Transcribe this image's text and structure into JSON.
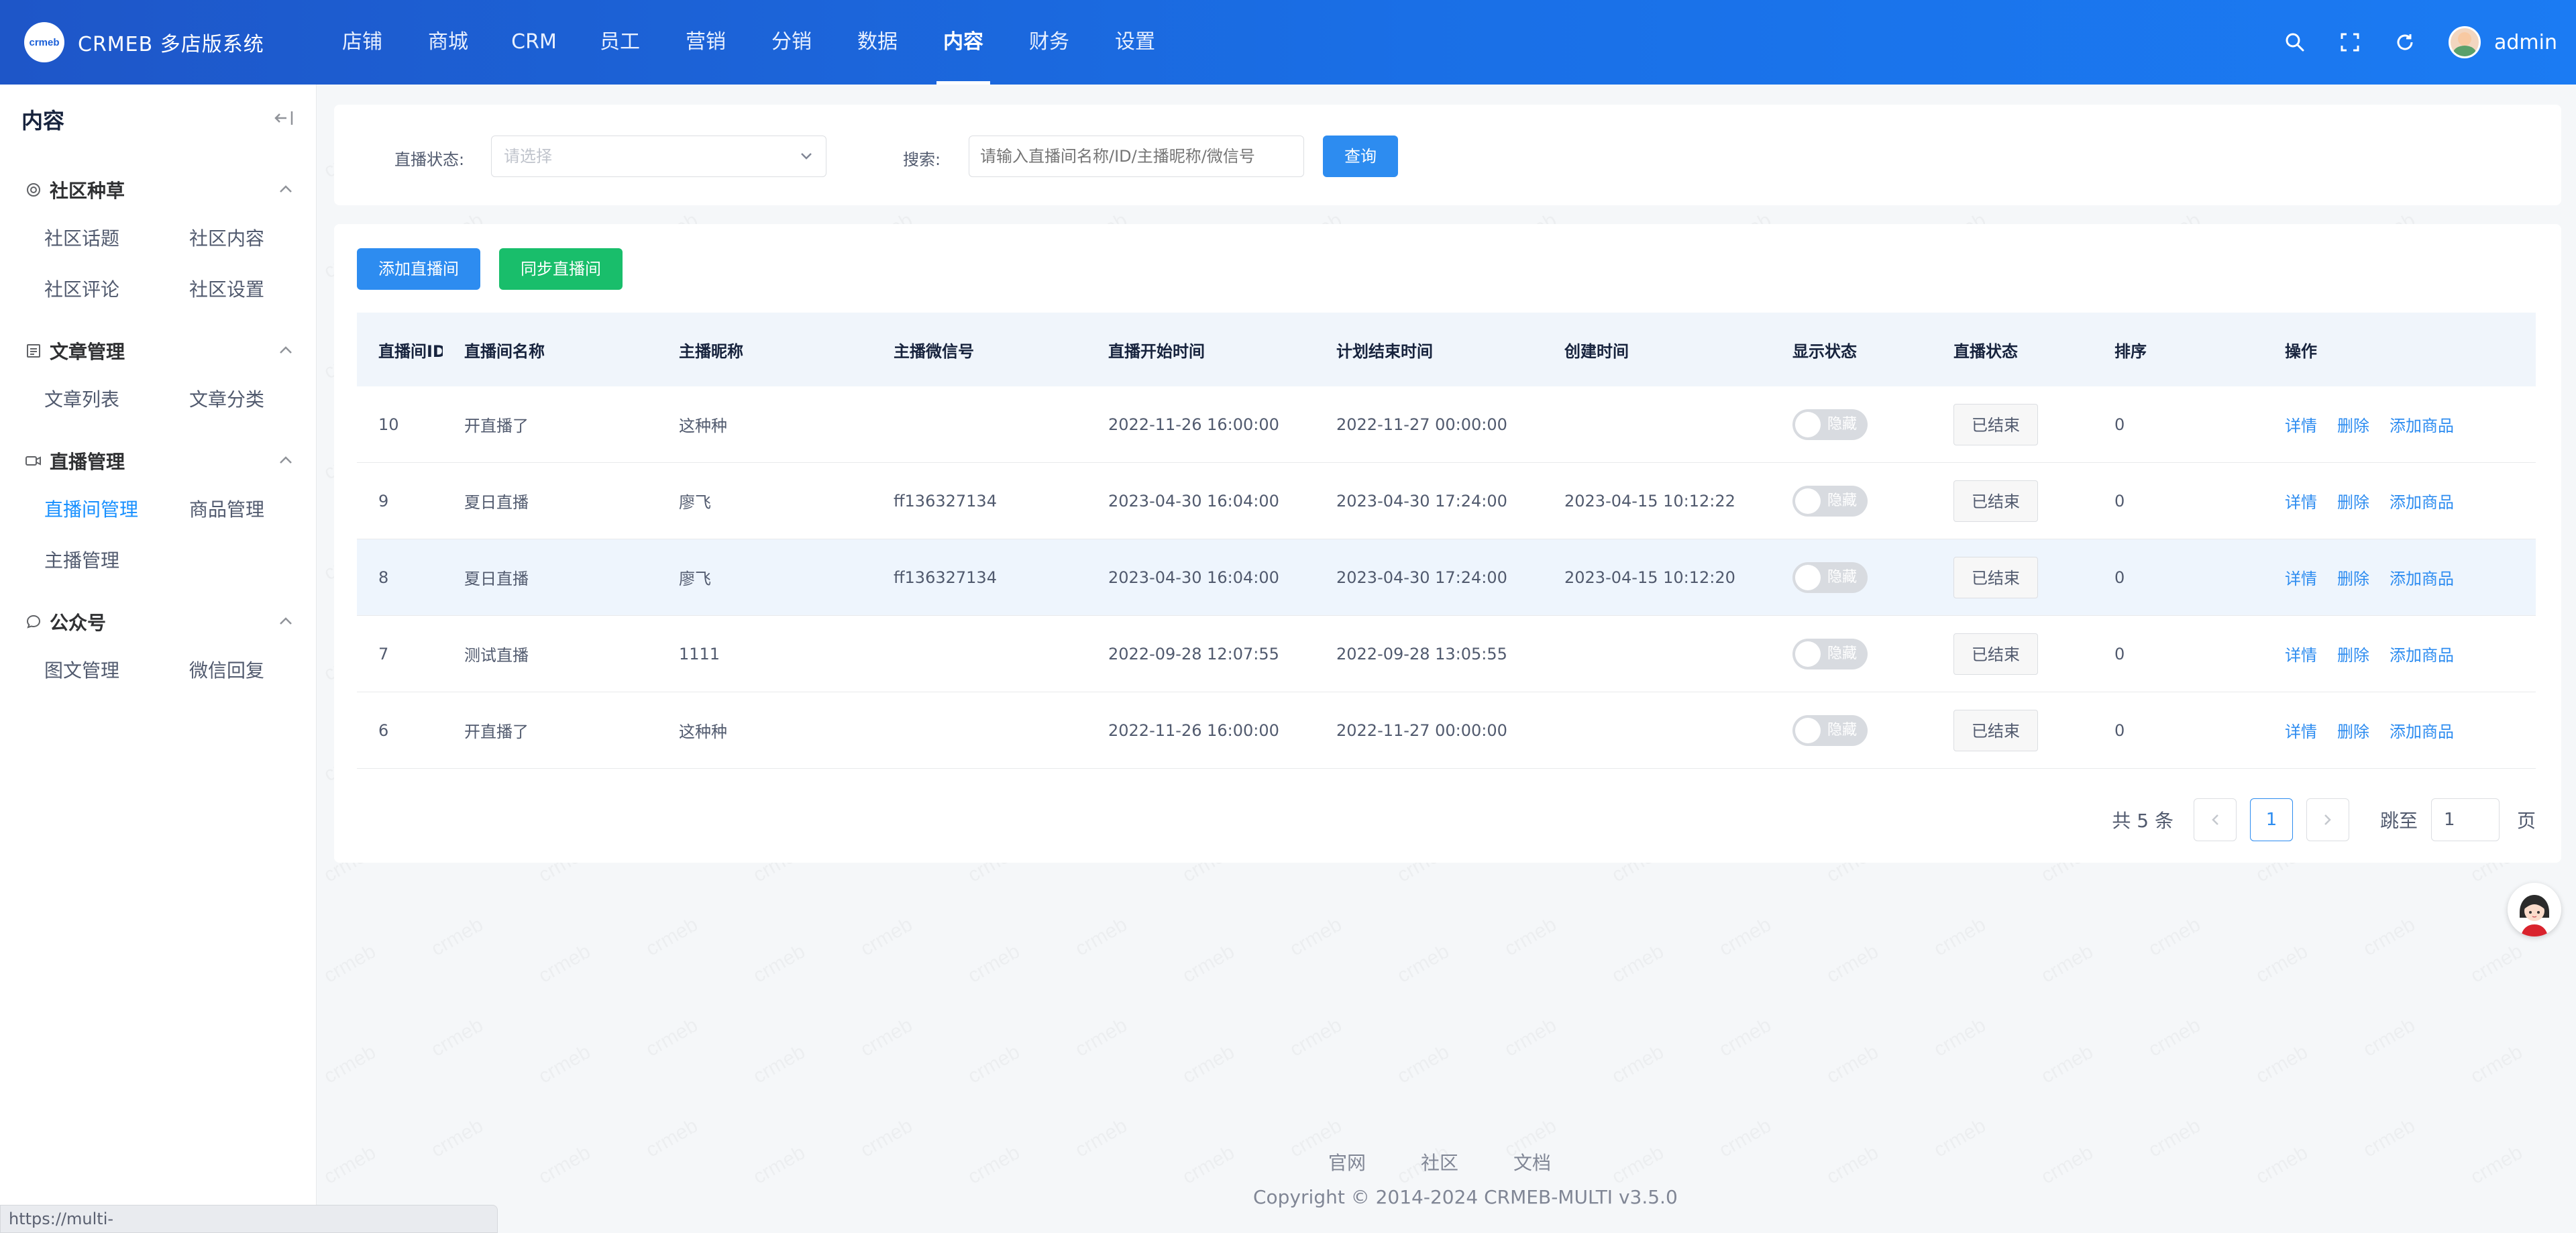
{
  "app": {
    "logo_badge": "crmeb",
    "name": "CRMEB 多店版系统",
    "admin": "admin",
    "accent": "#2d8cf0",
    "header_gradient": [
      "#1e56c8",
      "#1b7bf3"
    ]
  },
  "topnav": [
    {
      "label": "店铺"
    },
    {
      "label": "商城"
    },
    {
      "label": "CRM"
    },
    {
      "label": "员工"
    },
    {
      "label": "营销"
    },
    {
      "label": "分销"
    },
    {
      "label": "数据"
    },
    {
      "label": "内容",
      "active": true
    },
    {
      "label": "财务"
    },
    {
      "label": "设置"
    }
  ],
  "top_icons": [
    "search-icon",
    "fullscreen-icon",
    "refresh-icon"
  ],
  "sidebar": {
    "title": "内容",
    "sections": [
      {
        "icon": "target-icon",
        "label": "社区种草",
        "items": [
          "社区话题",
          "社区内容",
          "社区评论",
          "社区设置"
        ]
      },
      {
        "icon": "document-icon",
        "label": "文章管理",
        "items": [
          "文章列表",
          "文章分类"
        ]
      },
      {
        "icon": "video-icon",
        "label": "直播管理",
        "items": [
          "直播间管理",
          "商品管理",
          "主播管理"
        ],
        "active": "直播间管理"
      },
      {
        "icon": "chat-icon",
        "label": "公众号",
        "items": [
          "图文管理",
          "微信回复"
        ]
      }
    ]
  },
  "filter": {
    "status_label": "直播状态:",
    "status_placeholder": "请选择",
    "search_label": "搜索:",
    "search_placeholder": "请输入直播间名称/ID/主播昵称/微信号",
    "query_button": "查询"
  },
  "actions": {
    "add_button": "添加直播间",
    "sync_button": "同步直播间"
  },
  "table": {
    "columns": [
      "直播间ID",
      "直播间名称",
      "主播昵称",
      "主播微信号",
      "直播开始时间",
      "计划结束时间",
      "创建时间",
      "显示状态",
      "直播状态",
      "排序",
      "操作"
    ],
    "rows": [
      {
        "id": "10",
        "name": "开直播了",
        "anchor": "这种种",
        "wechat": "",
        "start": "2022-11-26 16:00:00",
        "end": "2022-11-27 00:00:00",
        "created": "",
        "show": "隐藏",
        "status": "已结束",
        "sort": "0"
      },
      {
        "id": "9",
        "name": "夏日直播",
        "anchor": "廖飞",
        "wechat": "ff136327134",
        "start": "2023-04-30 16:04:00",
        "end": "2023-04-30 17:24:00",
        "created": "2023-04-15 10:12:22",
        "show": "隐藏",
        "status": "已结束",
        "sort": "0"
      },
      {
        "id": "8",
        "name": "夏日直播",
        "anchor": "廖飞",
        "wechat": "ff136327134",
        "start": "2023-04-30 16:04:00",
        "end": "2023-04-30 17:24:00",
        "created": "2023-04-15 10:12:20",
        "show": "隐藏",
        "status": "已结束",
        "sort": "0"
      },
      {
        "id": "7",
        "name": "测试直播",
        "anchor": "1111",
        "wechat": "",
        "start": "2022-09-28 12:07:55",
        "end": "2022-09-28 13:05:55",
        "created": "",
        "show": "隐藏",
        "status": "已结束",
        "sort": "0"
      },
      {
        "id": "6",
        "name": "开直播了",
        "anchor": "这种种",
        "wechat": "",
        "start": "2022-11-26 16:00:00",
        "end": "2022-11-27 00:00:00",
        "created": "",
        "show": "隐藏",
        "status": "已结束",
        "sort": "0"
      }
    ],
    "ops": [
      "详情",
      "删除",
      "添加商品"
    ]
  },
  "pagination": {
    "total": "共 5 条",
    "current": "1",
    "jump_label": "跳至",
    "jump_value": "1",
    "unit": "页"
  },
  "footer": {
    "links": [
      "官网",
      "社区",
      "文档"
    ],
    "copyright": "Copyright © 2014-2024 CRMEB-MULTI v3.5.0"
  },
  "statusbar": "https://multi-store.crmeb.net/admin/marketing/live/live_goods",
  "watermark": "crmeb"
}
